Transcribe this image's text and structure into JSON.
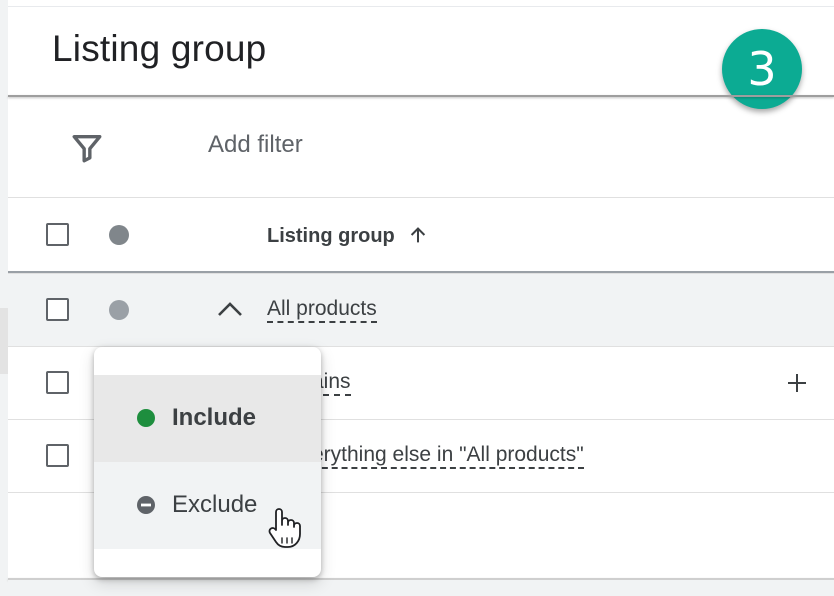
{
  "page": {
    "title": "Listing group",
    "step_badge": "3"
  },
  "filter_bar": {
    "add_filter_label": "Add filter",
    "icon": "filter-icon"
  },
  "table": {
    "header": {
      "column_label": "Listing group",
      "sort_icon": "arrow-up-icon"
    },
    "rows": [
      {
        "label": "All products",
        "expanded": true
      },
      {
        "label": "ains"
      },
      {
        "label": "erything else in \"All products\""
      }
    ]
  },
  "status_menu": {
    "items": [
      {
        "label": "Include",
        "color": "#1e8e3e",
        "icon": "green-dot-icon"
      },
      {
        "label": "Exclude",
        "color": "#5f6368",
        "icon": "minus-circle-icon"
      }
    ],
    "hovered": "Exclude"
  },
  "colors": {
    "badge": "#0cab93",
    "include": "#1e8e3e",
    "text": "#3c4043",
    "muted": "#5f6368"
  }
}
